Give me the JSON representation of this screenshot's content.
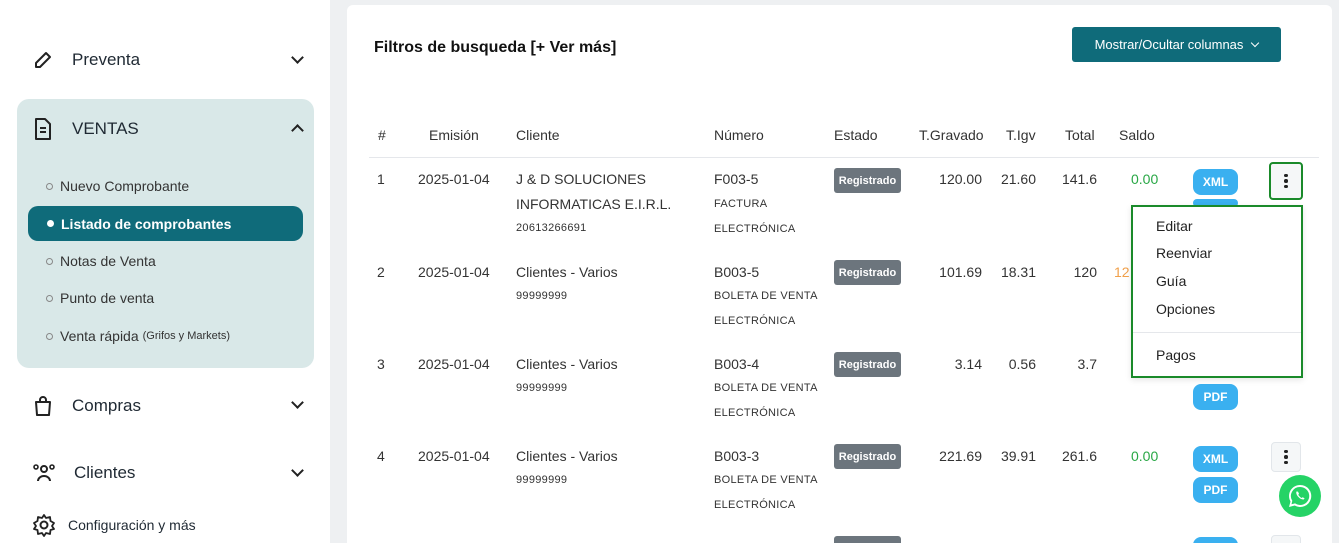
{
  "sidebar": {
    "preventa": "Preventa",
    "ventas": "VENTAS",
    "sub_items": [
      "Nuevo Comprobante",
      "Listado de comprobantes",
      "Notas de Venta",
      "Punto de venta",
      "Venta rápida"
    ],
    "venta_rapida_note": "(Grifos y Markets)",
    "compras": "Compras",
    "clientes": "Clientes",
    "config": "Configuración y más"
  },
  "toolbar": {
    "filters": "Filtros de busqueda [+ Ver más]",
    "columns_button": "Mostrar/Ocultar columnas"
  },
  "table": {
    "headers": [
      "#",
      "Emisión",
      "Cliente",
      "Número",
      "Estado",
      "T.Gravado",
      "T.Igv",
      "Total",
      "Saldo"
    ],
    "rows": [
      {
        "n": "1",
        "fecha": "2025-01-04",
        "cliente1": "J & D SOLUCIONES",
        "cliente2": "INFORMATICAS E.I.R.L.",
        "doc": "20613266691",
        "numero": "F003-5",
        "tipo1": "FACTURA",
        "tipo2": "ELECTRÓNICA",
        "estado": "Registrado",
        "gravado": "120.00",
        "igv": "21.60",
        "total": "141.6",
        "saldo": "0.00"
      },
      {
        "n": "2",
        "fecha": "2025-01-04",
        "cliente1": "Clientes - Varios",
        "doc": "99999999",
        "numero": "B003-5",
        "tipo1": "BOLETA DE VENTA",
        "tipo2": "ELECTRÓNICA",
        "estado": "Registrado",
        "gravado": "101.69",
        "igv": "18.31",
        "total": "120",
        "saldo": "12"
      },
      {
        "n": "3",
        "fecha": "2025-01-04",
        "cliente1": "Clientes - Varios",
        "doc": "99999999",
        "numero": "B003-4",
        "tipo1": "BOLETA DE VENTA",
        "tipo2": "ELECTRÓNICA",
        "estado": "Registrado",
        "gravado": "3.14",
        "igv": "0.56",
        "total": "3.7",
        "saldo": ""
      },
      {
        "n": "4",
        "fecha": "2025-01-04",
        "cliente1": "Clientes - Varios",
        "doc": "99999999",
        "numero": "B003-3",
        "tipo1": "BOLETA DE VENTA",
        "tipo2": "ELECTRÓNICA",
        "estado": "Registrado",
        "gravado": "221.69",
        "igv": "39.91",
        "total": "261.6",
        "saldo": "0.00"
      }
    ],
    "xml_label": "XML",
    "pdf_label": "PDF"
  },
  "dropdown": {
    "items": [
      "Editar",
      "Reenviar",
      "Guía",
      "Opciones",
      "Pagos"
    ]
  },
  "colors": {
    "primary": "#0f6b7a",
    "badge": "#6c757d",
    "xml_pdf": "#3ab0f0",
    "focus": "#1a8a2a"
  }
}
